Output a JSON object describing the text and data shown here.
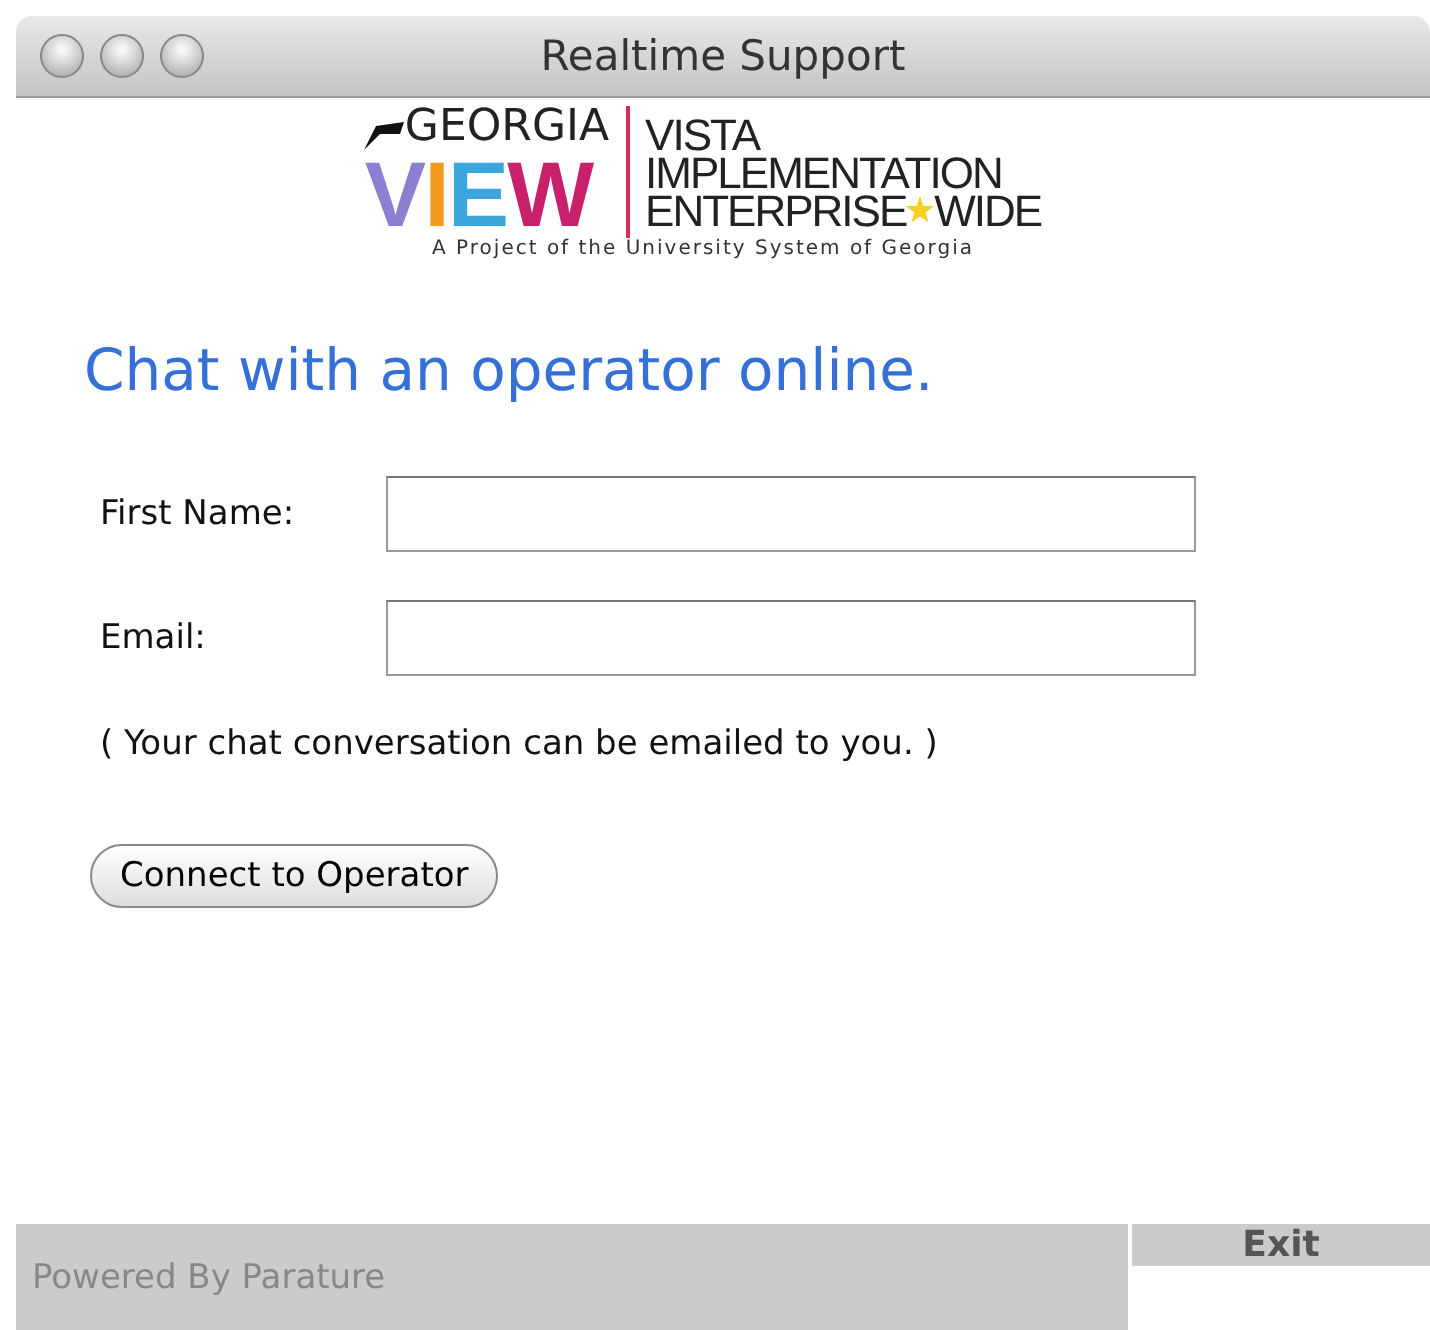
{
  "window": {
    "title": "Realtime Support"
  },
  "logo": {
    "top": "GEORGIA",
    "mark": "VIEW",
    "lines": [
      "VISTA",
      "IMPLEMENTATION"
    ],
    "last_left": "ENTERPRISE",
    "last_right": "WIDE",
    "tagline": "A Project of the University System of Georgia"
  },
  "heading": "Chat with an operator online.",
  "fields": [
    {
      "label": "First Name:"
    },
    {
      "label": "Email:"
    }
  ],
  "note": "( Your chat conversation can be emailed to you. )",
  "button": "Connect to Operator",
  "footer": {
    "credit": "Powered By Parature",
    "exit": "Exit"
  }
}
